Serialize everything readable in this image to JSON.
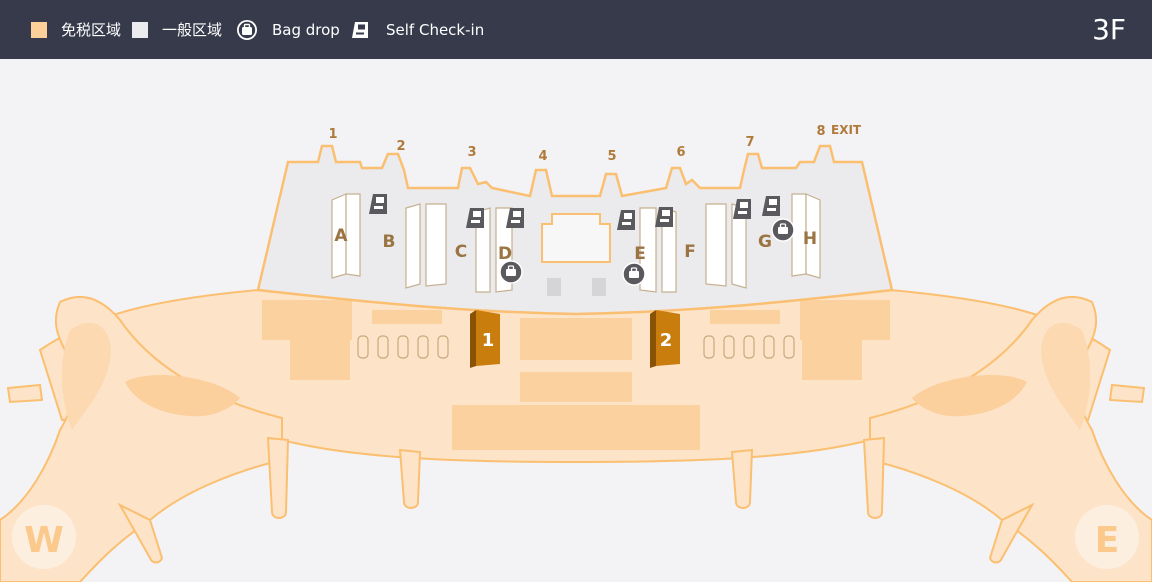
{
  "legend": {
    "duty_free_label": "免税区域",
    "general_label": "一般区域",
    "bag_drop_label": "Bag drop",
    "self_checkin_label": "Self Check-in"
  },
  "floor": "3F",
  "gates": [
    "1",
    "2",
    "3",
    "4",
    "5",
    "6",
    "7",
    "8"
  ],
  "exit_label": "EXIT",
  "counters": [
    "A",
    "B",
    "C",
    "D",
    "E",
    "F",
    "G",
    "H"
  ],
  "security_gates": [
    "1",
    "2"
  ],
  "compass": {
    "west": "W",
    "east": "E"
  },
  "colors": {
    "header_bg": "#363a4b",
    "duty_free": "#fdd09a",
    "general": "#ebebed",
    "accent": "#c47a0a",
    "label": "#b07a3b",
    "icon": "#59595e"
  },
  "icons": [
    "bag-drop-icon",
    "self-checkin-icon"
  ]
}
